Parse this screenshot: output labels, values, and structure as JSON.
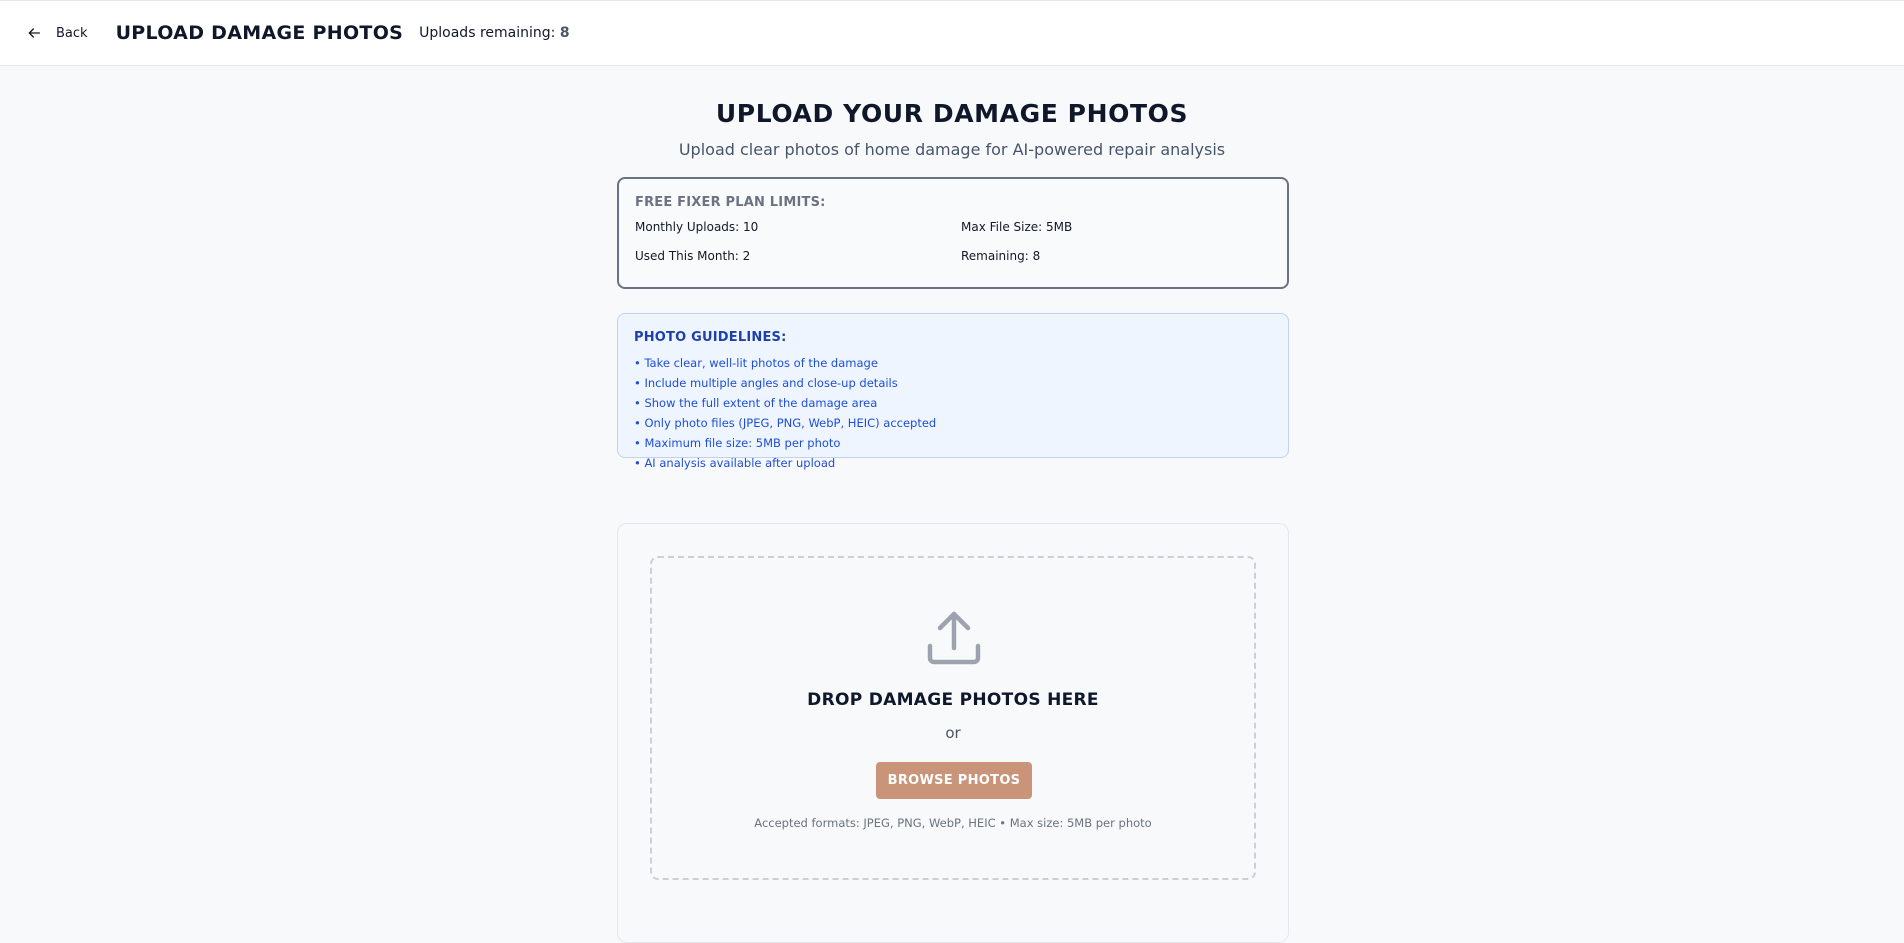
{
  "header": {
    "back_label": "Back",
    "title": "UPLOAD DAMAGE PHOTOS",
    "uploads_remaining_label": "Uploads remaining:",
    "uploads_remaining_count": "8"
  },
  "page": {
    "title": "UPLOAD YOUR DAMAGE PHOTOS",
    "subtitle": "Upload clear photos of home damage for AI-powered repair analysis"
  },
  "plan_limits": {
    "title": "FREE FIXER PLAN LIMITS:",
    "monthly_uploads": "Monthly Uploads: 10",
    "max_file_size": "Max File Size: 5MB",
    "used_this_month": "Used This Month: 2",
    "remaining": "Remaining: 8"
  },
  "guidelines": {
    "title": "PHOTO GUIDELINES:",
    "items": [
      "• Take clear, well-lit photos of the damage",
      "• Include multiple angles and close-up details",
      "• Show the full extent of the damage area",
      "• Only photo files (JPEG, PNG, WebP, HEIC) accepted",
      "• Maximum file size: 5MB per photo",
      "• AI analysis available after upload"
    ]
  },
  "dropzone": {
    "icon": "upload-icon",
    "title": "DROP DAMAGE PHOTOS HERE",
    "or_text": "or",
    "browse_label": "BROWSE PHOTOS",
    "accepted_text": "Accepted formats: JPEG, PNG, WebP, HEIC • Max size: 5MB per photo"
  },
  "colors": {
    "browse_button": "#c9947a",
    "guideline_text": "#1d4ed8",
    "guideline_bg": "#eef5ff"
  }
}
